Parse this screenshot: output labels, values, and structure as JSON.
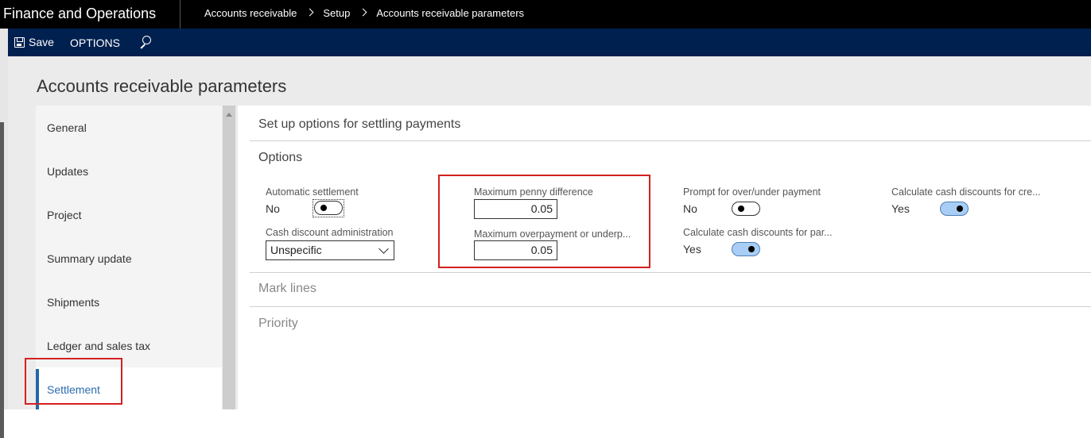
{
  "app": {
    "title": "Finance and Operations"
  },
  "breadcrumb": [
    "Accounts receivable",
    "Setup",
    "Accounts receivable parameters"
  ],
  "actionbar": {
    "save_label": "Save",
    "options_label": "OPTIONS"
  },
  "page": {
    "title": "Accounts receivable parameters"
  },
  "nav": {
    "items": [
      {
        "label": "General"
      },
      {
        "label": "Updates"
      },
      {
        "label": "Project"
      },
      {
        "label": "Summary update"
      },
      {
        "label": "Shipments"
      },
      {
        "label": "Ledger and sales tax"
      },
      {
        "label": "Settlement"
      }
    ],
    "active": "Settlement"
  },
  "content": {
    "heading": "Set up options for settling payments",
    "options_header": "Options",
    "mark_lines_header": "Mark lines",
    "priority_header": "Priority",
    "fields": {
      "automatic_settlement": {
        "label": "Automatic settlement",
        "value": "No"
      },
      "cash_discount_admin": {
        "label": "Cash discount administration",
        "value": "Unspecific"
      },
      "max_penny_difference": {
        "label": "Maximum penny difference",
        "value": "0.05"
      },
      "max_overpayment": {
        "label": "Maximum overpayment or underp...",
        "value": "0.05"
      },
      "prompt_over_under": {
        "label": "Prompt for over/under payment",
        "value": "No"
      },
      "calc_cash_disc_par": {
        "label": "Calculate cash discounts for par...",
        "value": "Yes"
      },
      "calc_cash_disc_cre": {
        "label": "Calculate cash discounts for cre...",
        "value": "Yes"
      }
    }
  },
  "colors": {
    "topbar": "#000000",
    "actionbar": "#002050",
    "accent": "#2266aa",
    "highlight": "#d42020",
    "toggle_on": "#a9cef5"
  },
  "icons": {
    "save": "save-icon",
    "search": "search-icon",
    "chevron": "chevron-right-icon",
    "dropdown": "chevron-down-icon"
  }
}
